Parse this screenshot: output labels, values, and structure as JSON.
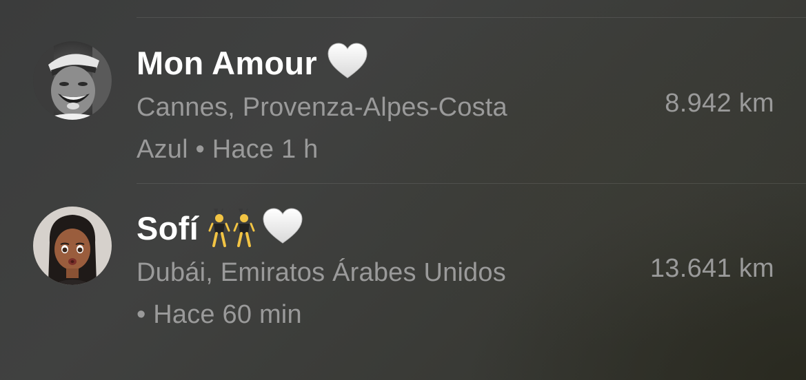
{
  "contacts": [
    {
      "name": "Mon Amour",
      "emoji": [
        "white-heart"
      ],
      "location_line1": "Cannes, Provenza-Alpes-Costa",
      "location_line2": "Azul • Hace 1 h",
      "distance": "8.942 km"
    },
    {
      "name": "Sofí",
      "emoji": [
        "women-with-bunny-ears",
        "white-heart"
      ],
      "location_line1": "Dubái, Emiratos Árabes Unidos",
      "location_line2": "• Hace 60 min",
      "distance": "13.641 km"
    }
  ],
  "colors": {
    "name_text": "#ffffff",
    "secondary_text": "#9a9a9a",
    "background": "#3d3e3c"
  }
}
